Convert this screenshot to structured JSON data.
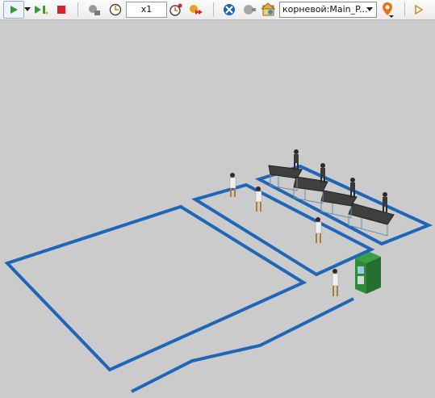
{
  "toolbar": {
    "speed_value": "x1",
    "view_area_selected": "корневой:Main_P..."
  },
  "colors": {
    "canvas_background": "#cbcbcb",
    "area_outline": "#1f66b8",
    "play_green": "#2fa02f",
    "stop_red": "#d9232a",
    "atm_green": "#2e8b3a"
  },
  "icons": [
    "play-icon",
    "dropdown-arrow-icon",
    "run-until-icon",
    "stop-icon",
    "step-icon",
    "clock-icon",
    "speed-up-icon",
    "fast-forward-icon",
    "navigate-icon",
    "camera-icon",
    "home-view-icon",
    "location-pin-icon",
    "more-icon"
  ]
}
